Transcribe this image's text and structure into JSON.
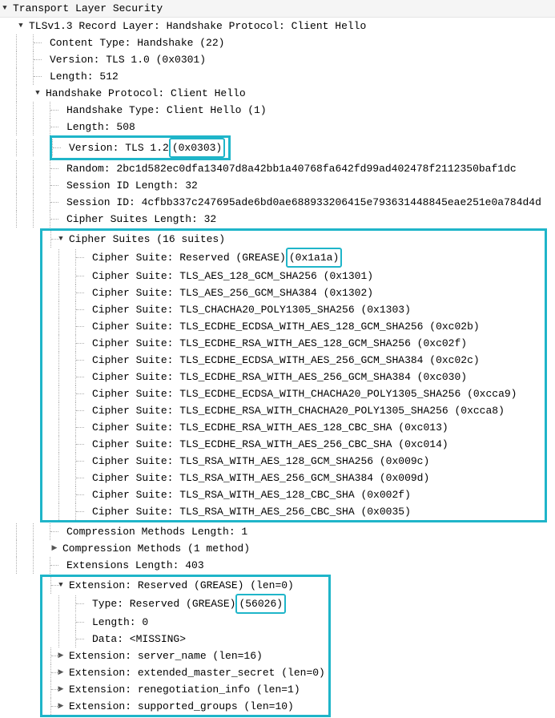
{
  "root": {
    "label": "Transport Layer Security"
  },
  "record": {
    "label": "TLSv1.3 Record Layer: Handshake Protocol: Client Hello"
  },
  "contentType": "Content Type: Handshake (22)",
  "version": "Version: TLS 1.0 (0x0301)",
  "length": "Length: 512",
  "handshake": {
    "label": "Handshake Protocol: Client Hello"
  },
  "hsType": "Handshake Type: Client Hello (1)",
  "hsLength": "Length: 508",
  "hsVersionPrefix": "Version: TLS 1.2 ",
  "hsVersionCode": "(0x0303)",
  "random": "Random: 2bc1d582ec0dfa13407d8a42bb1a40768fa642fd99ad402478f2112350baf1dc",
  "sidLen": "Session ID Length: 32",
  "sid": "Session ID: 4cfbb337c247695ade6bd0ae688933206415e793631448845eae251e0a784d4d",
  "csLen": "Cipher Suites Length: 32",
  "cipherSuites": {
    "header": "Cipher Suites (16 suites)",
    "first": {
      "prefix": "Cipher Suite: Reserved (GREASE) ",
      "code": "(0x1a1a)"
    },
    "rest": [
      "Cipher Suite: TLS_AES_128_GCM_SHA256 (0x1301)",
      "Cipher Suite: TLS_AES_256_GCM_SHA384 (0x1302)",
      "Cipher Suite: TLS_CHACHA20_POLY1305_SHA256 (0x1303)",
      "Cipher Suite: TLS_ECDHE_ECDSA_WITH_AES_128_GCM_SHA256 (0xc02b)",
      "Cipher Suite: TLS_ECDHE_RSA_WITH_AES_128_GCM_SHA256 (0xc02f)",
      "Cipher Suite: TLS_ECDHE_ECDSA_WITH_AES_256_GCM_SHA384 (0xc02c)",
      "Cipher Suite: TLS_ECDHE_RSA_WITH_AES_256_GCM_SHA384 (0xc030)",
      "Cipher Suite: TLS_ECDHE_ECDSA_WITH_CHACHA20_POLY1305_SHA256 (0xcca9)",
      "Cipher Suite: TLS_ECDHE_RSA_WITH_CHACHA20_POLY1305_SHA256 (0xcca8)",
      "Cipher Suite: TLS_ECDHE_RSA_WITH_AES_128_CBC_SHA (0xc013)",
      "Cipher Suite: TLS_ECDHE_RSA_WITH_AES_256_CBC_SHA (0xc014)",
      "Cipher Suite: TLS_RSA_WITH_AES_128_GCM_SHA256 (0x009c)",
      "Cipher Suite: TLS_RSA_WITH_AES_256_GCM_SHA384 (0x009d)",
      "Cipher Suite: TLS_RSA_WITH_AES_128_CBC_SHA (0x002f)",
      "Cipher Suite: TLS_RSA_WITH_AES_256_CBC_SHA (0x0035)"
    ]
  },
  "compressionLen": "Compression Methods Length: 1",
  "compression": "Compression Methods (1 method)",
  "extLen": "Extensions Length: 403",
  "extGrease": {
    "header": "Extension: Reserved (GREASE) (len=0)",
    "type": {
      "prefix": "Type: Reserved (GREASE) ",
      "code": "(56026)"
    },
    "length": "Length: 0",
    "data": "Data: <MISSING>"
  },
  "extensions": [
    "Extension: server_name (len=16)",
    "Extension: extended_master_secret (len=0)",
    "Extension: renegotiation_info (len=1)",
    "Extension: supported_groups (len=10)"
  ]
}
